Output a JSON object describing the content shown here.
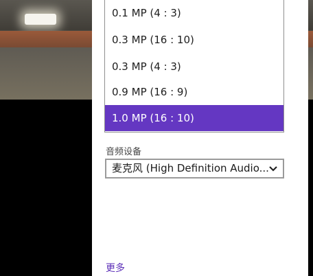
{
  "resolution_options": [
    {
      "label": "0.1 MP (4 : 3)",
      "selected": false
    },
    {
      "label": "0.3 MP (16 : 10)",
      "selected": false
    },
    {
      "label": "0.3 MP (4 : 3)",
      "selected": false
    },
    {
      "label": "0.9 MP (16 : 9)",
      "selected": false
    },
    {
      "label": "1.0 MP (16 : 10)",
      "selected": true
    }
  ],
  "audio": {
    "label": "音频设备",
    "value": "麦克风 (High Definition Audio..."
  },
  "more_link": "更多",
  "colors": {
    "accent": "#6437c2",
    "link": "#5c2fb8"
  },
  "icons": {
    "select_chevron": "chevron-down-icon"
  }
}
